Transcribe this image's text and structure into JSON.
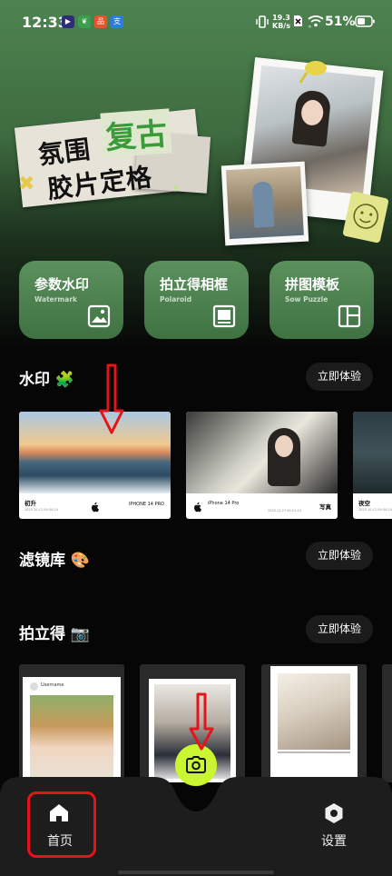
{
  "status_bar": {
    "time": "12:33",
    "net_speed_value": "19.3",
    "net_speed_unit": "KB/s",
    "battery": "51%"
  },
  "hero": {
    "title_line1": "氛围",
    "title_highlight": "复古",
    "title_line2": "胶片定格"
  },
  "features": [
    {
      "title": "参数水印",
      "subtitle": "Watermark",
      "icon": "image-watermark-icon"
    },
    {
      "title": "拍立得相框",
      "subtitle": "Polaroid",
      "icon": "polaroid-frame-icon"
    },
    {
      "title": "拼图模板",
      "subtitle": "Sow Puzzle",
      "icon": "puzzle-layout-icon"
    }
  ],
  "sections": {
    "watermark": {
      "title": "水印 🧩",
      "button": "立即体验"
    },
    "filters": {
      "title": "滤镜库 🎨",
      "button": "立即体验"
    },
    "polaroid": {
      "title": "拍立得 📷",
      "button": "立即体验"
    }
  },
  "watermark_samples": [
    {
      "caption": "初升",
      "date": "2023.10.11 09:30:14",
      "device": "IPHONE 14 PRO"
    },
    {
      "device": "iPhone 14 Pro",
      "date": "2023.11.27 09:21:13",
      "caption": "写真"
    },
    {
      "caption": "夜空",
      "date": "2023.10.11 09:30:14"
    }
  ],
  "polaroid_samples": [
    {
      "username": "Username"
    }
  ],
  "bottom_nav": {
    "home_label": "首页",
    "settings_label": "设置"
  },
  "colors": {
    "accent": "#c9f531",
    "card_green": "#4f8551",
    "annotation_red": "#e4141b"
  }
}
